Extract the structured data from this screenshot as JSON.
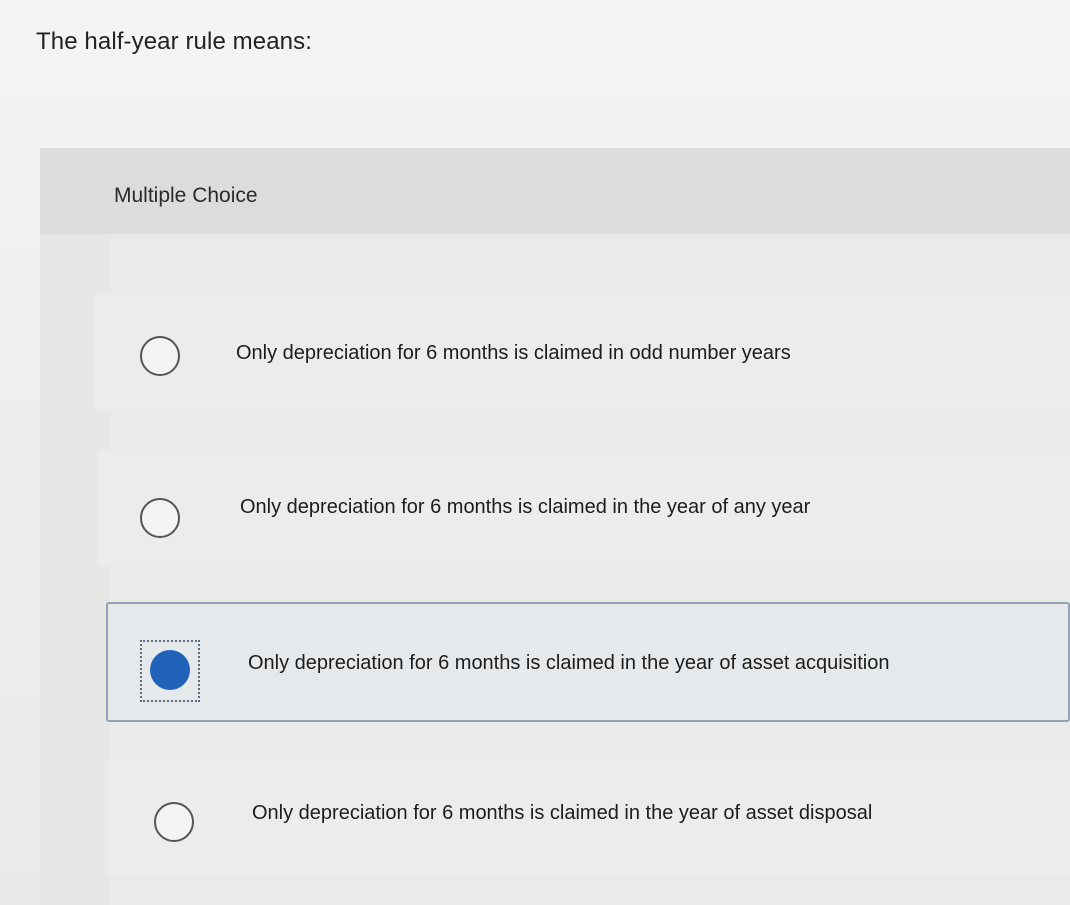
{
  "question": {
    "text": "The half-year rule means:"
  },
  "panel": {
    "type_label": "Multiple Choice"
  },
  "options": [
    {
      "label": "Only depreciation for 6 months is claimed in odd number years",
      "selected": false
    },
    {
      "label": "Only depreciation for 6 months is claimed in the year of any year",
      "selected": false
    },
    {
      "label": "Only depreciation for 6 months is claimed in the year of asset acquisition",
      "selected": true
    },
    {
      "label": "Only depreciation for 6 months is claimed in the year of asset disposal",
      "selected": false
    }
  ],
  "colors": {
    "selected_fill": "#1f62b8",
    "selected_border": "#8fa3b8"
  }
}
